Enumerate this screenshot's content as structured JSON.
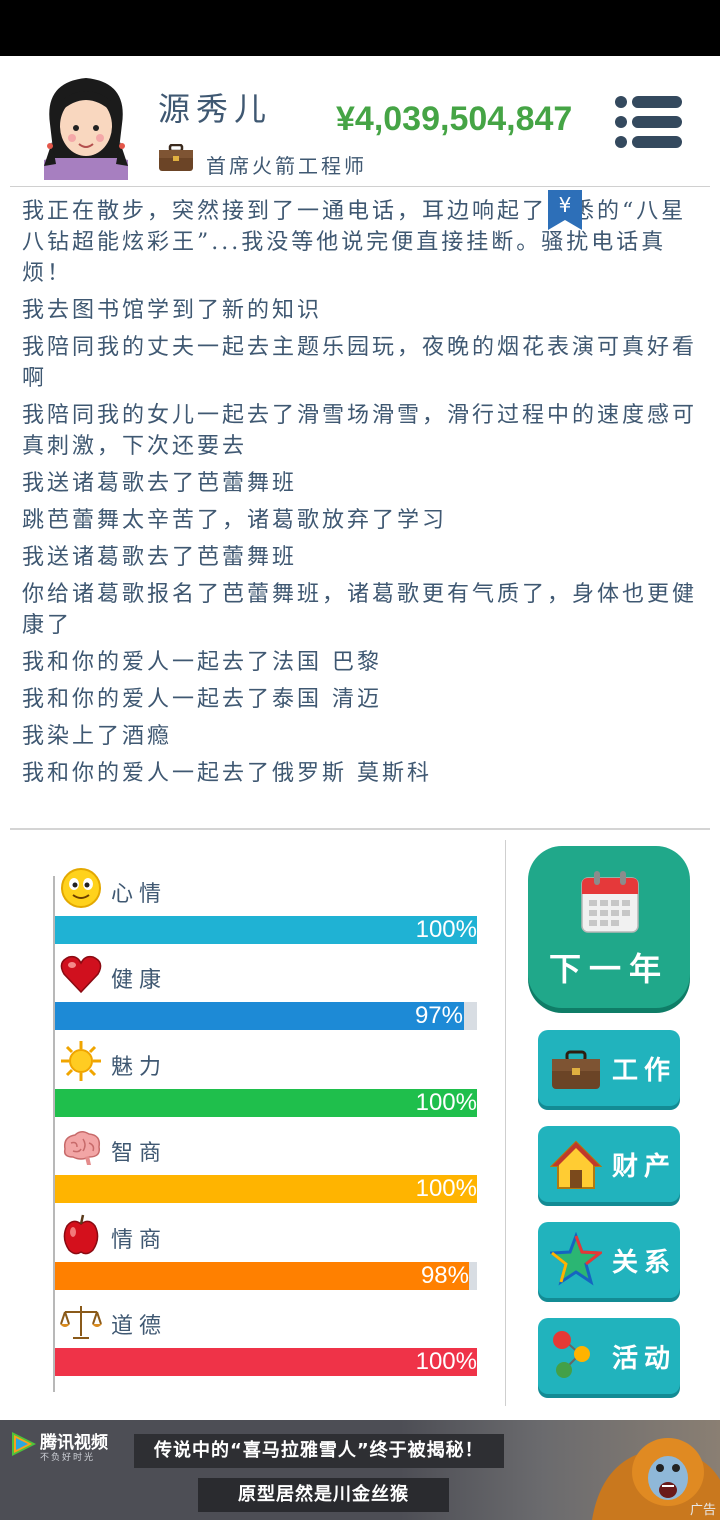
{
  "header": {
    "name": "源秀儿",
    "job": "首席火箭工程师",
    "money": "¥4,039,504,847"
  },
  "log": [
    "我正在散步，突然接到了一通电话，耳边响起了熟悉的“八星八钻超能炫彩王”...我没等他说完便直接挂断。骚扰电话真烦！",
    "我去图书馆学到了新的知识",
    "我陪同我的丈夫一起去主题乐园玩，夜晚的烟花表演可真好看啊",
    "我陪同我的女儿一起去了滑雪场滑雪，滑行过程中的速度感可真刺激，下次还要去",
    "我送诸葛歌去了芭蕾舞班",
    "跳芭蕾舞太辛苦了，诸葛歌放弃了学习",
    "我送诸葛歌去了芭蕾舞班",
    "你给诸葛歌报名了芭蕾舞班，诸葛歌更有气质了，身体也更健康了",
    "我和你的爱人一起去了法国 巴黎",
    "我和你的爱人一起去了泰国 清迈",
    "我染上了酒瘾",
    "我和你的爱人一起去了俄罗斯 莫斯科"
  ],
  "yen_marker": "¥",
  "stats": [
    {
      "label": "心情",
      "value": 100,
      "text": "100%",
      "color": "#1fb2d4",
      "icon": "smiley-icon"
    },
    {
      "label": "健康",
      "value": 97,
      "text": "97%",
      "color": "#1d8ad6",
      "icon": "heart-icon"
    },
    {
      "label": "魅力",
      "value": 100,
      "text": "100%",
      "color": "#1fbf4c",
      "icon": "sun-icon"
    },
    {
      "label": "智商",
      "value": 100,
      "text": "100%",
      "color": "#ffb400",
      "icon": "brain-icon"
    },
    {
      "label": "情商",
      "value": 98,
      "text": "98%",
      "color": "#ff8000",
      "icon": "apple-icon"
    },
    {
      "label": "道德",
      "value": 100,
      "text": "100%",
      "color": "#ef3348",
      "icon": "scales-icon"
    }
  ],
  "buttons": {
    "next_year": "下一年",
    "work": "工作",
    "assets": "财产",
    "relations": "关系",
    "activities": "活动"
  },
  "ad": {
    "brand": "腾讯视频",
    "slogan": "不负好时光",
    "line1": "传说中的“喜马拉雅雪人”终于被揭秘！",
    "line2": "原型居然是川金丝猴",
    "tag": "广告"
  },
  "colors": {
    "money": "#45a445",
    "text": "#3f5872",
    "next_button": "#20a88a",
    "side_button": "#21b3bd"
  }
}
